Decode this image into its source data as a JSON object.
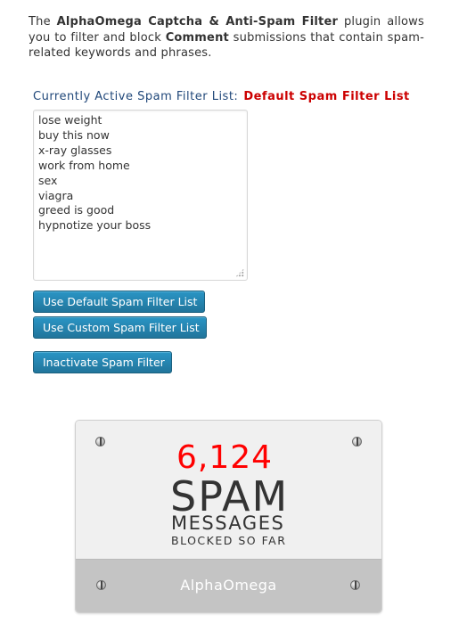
{
  "intro": {
    "prefix": "The ",
    "plugin_name": "AlphaOmega Captcha & Anti-Spam Filter",
    "middle": " plugin allows you to filter and block ",
    "comment": "Comment",
    "suffix": " submissions that contain spam-related keywords and phrases."
  },
  "active_list": {
    "label": "Currently Active Spam Filter List:",
    "value": "Default Spam Filter List",
    "value_color": "#cc0000"
  },
  "filter_terms": [
    "lose weight",
    "buy this now",
    "x-ray glasses",
    "work from home",
    "sex",
    "viagra",
    "greed is good",
    "hypnotize your boss"
  ],
  "buttons": {
    "use_default": "Use Default Spam Filter List",
    "use_custom": "Use Custom Spam Filter List",
    "inactivate": "Inactivate Spam Filter"
  },
  "counter_badge": {
    "count": "6,124",
    "count_color": "#ff0000",
    "line1": "SPAM",
    "line2": "MESSAGES",
    "line3": "BLOCKED SO FAR",
    "brand": "AlphaOmega"
  },
  "colors": {
    "button_bg": "#21759b",
    "label_blue": "#21487a"
  }
}
